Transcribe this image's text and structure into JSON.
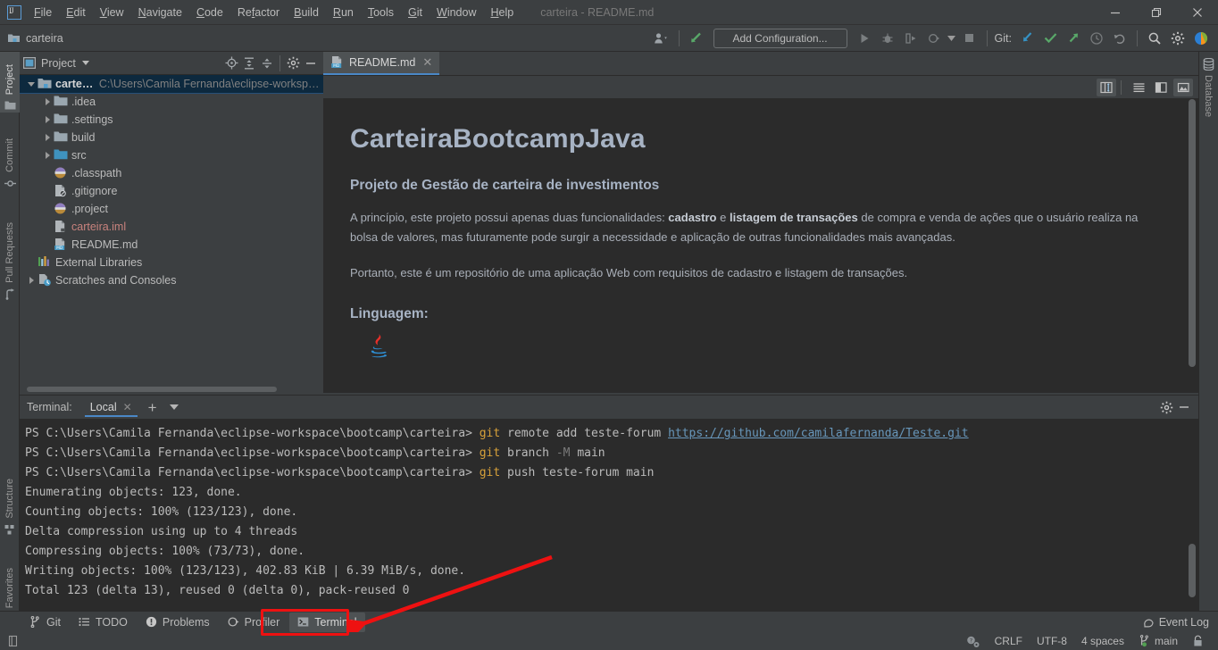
{
  "window": {
    "title": "carteira - README.md",
    "logo": "intellij-idea-logo",
    "minimize": "—",
    "maximize": "❐",
    "close": "✕"
  },
  "menubar": [
    {
      "label": "File",
      "mnemonic": "F"
    },
    {
      "label": "Edit",
      "mnemonic": "E"
    },
    {
      "label": "View",
      "mnemonic": "V"
    },
    {
      "label": "Navigate",
      "mnemonic": "N"
    },
    {
      "label": "Code",
      "mnemonic": "C"
    },
    {
      "label": "Refactor",
      "mnemonic": "R"
    },
    {
      "label": "Build",
      "mnemonic": "B"
    },
    {
      "label": "Run",
      "mnemonic": "R"
    },
    {
      "label": "Tools",
      "mnemonic": "T"
    },
    {
      "label": "Git",
      "mnemonic": "G"
    },
    {
      "label": "Window",
      "mnemonic": "W"
    },
    {
      "label": "Help",
      "mnemonic": "H"
    }
  ],
  "toolbar": {
    "breadcrumb": "carteira",
    "run_configuration": "Add Configuration...",
    "git_label": "Git:",
    "icons": [
      "user-profile-icon",
      "chevron-down-icon",
      "update-project-icon",
      "run-icon",
      "debug-icon",
      "run-coverage-icon",
      "profile-icon",
      "stop-icon",
      "update-git-icon",
      "commit-icon",
      "push-icon",
      "history-icon",
      "rollback-icon",
      "search-everywhere-icon",
      "settings-icon",
      "ide-feedback-icon"
    ]
  },
  "left_stripe": [
    {
      "label": "Project",
      "icon": "project-icon",
      "active": true
    },
    {
      "label": "Commit",
      "icon": "commit-icon",
      "active": false
    },
    {
      "label": "Pull Requests",
      "icon": "pull-requests-icon",
      "active": false
    },
    {
      "label": "Structure",
      "icon": "structure-icon",
      "active": false
    },
    {
      "label": "Favorites",
      "icon": "star-icon",
      "active": false
    }
  ],
  "right_stripe": [
    {
      "label": "Database",
      "icon": "database-icon",
      "active": false
    }
  ],
  "project_panel": {
    "title": "Project",
    "header_icons": [
      "select-opened-file-icon",
      "expand-all-icon",
      "collapse-all-icon",
      "settings-icon",
      "hide-icon"
    ],
    "tree": [
      {
        "label": "carteira",
        "detail": "C:\\Users\\Camila Fernanda\\eclipse-workspace\\b",
        "indent": 0,
        "twisty": "down",
        "icon": "project-folder-icon",
        "selected": true,
        "bold": true
      },
      {
        "label": ".idea",
        "detail": "",
        "indent": 1,
        "twisty": "right",
        "icon": "folder-icon",
        "selected": false,
        "bold": false
      },
      {
        "label": ".settings",
        "detail": "",
        "indent": 1,
        "twisty": "right",
        "icon": "folder-icon",
        "selected": false,
        "bold": false
      },
      {
        "label": "build",
        "detail": "",
        "indent": 1,
        "twisty": "right",
        "icon": "folder-icon",
        "selected": false,
        "bold": false
      },
      {
        "label": "src",
        "detail": "",
        "indent": 1,
        "twisty": "right",
        "icon": "source-folder-icon",
        "selected": false,
        "bold": false
      },
      {
        "label": ".classpath",
        "detail": "",
        "indent": 1,
        "twisty": "none",
        "icon": "file-classpath-icon",
        "selected": false,
        "bold": false
      },
      {
        "label": ".gitignore",
        "detail": "",
        "indent": 1,
        "twisty": "none",
        "icon": "file-gitignore-icon",
        "selected": false,
        "bold": false
      },
      {
        "label": ".project",
        "detail": "",
        "indent": 1,
        "twisty": "none",
        "icon": "file-classpath-icon",
        "selected": false,
        "bold": false
      },
      {
        "label": "carteira.iml",
        "detail": "",
        "indent": 1,
        "twisty": "none",
        "icon": "file-iml-icon",
        "selected": false,
        "bold": false,
        "color": "red"
      },
      {
        "label": "README.md",
        "detail": "",
        "indent": 1,
        "twisty": "none",
        "icon": "markdown-icon",
        "selected": false,
        "bold": false
      },
      {
        "label": "External Libraries",
        "detail": "",
        "indent": 0,
        "twisty": "none",
        "icon": "libraries-icon",
        "selected": false,
        "bold": false
      },
      {
        "label": "Scratches and Consoles",
        "detail": "",
        "indent": 0,
        "twisty": "right",
        "icon": "scratches-icon",
        "selected": false,
        "bold": false
      }
    ]
  },
  "editor": {
    "tab": {
      "label": "README.md",
      "icon": "markdown-icon",
      "close": "✕"
    },
    "preview_buttons": [
      "split-layout-icon",
      "show-source-icon",
      "show-split-icon",
      "show-preview-icon"
    ],
    "markdown": {
      "h1": "CarteiraBootcampJava",
      "h3": "Projeto de Gestão de carteira de investimentos",
      "p1_a": "A princípio, este projeto possui apenas duas funcionalidades: ",
      "p1_b1": "cadastro",
      "p1_c": " e ",
      "p1_b2": "listagem de transações",
      "p1_d": " de compra e venda de ações que o usuário realiza na bolsa de valores, mas futuramente pode surgir a necessidade e aplicação de outras funcionalidades mais avançadas.",
      "p2": "Portanto, este é um repositório de uma aplicação Web com requisitos de cadastro e listagem de transações.",
      "h3b": "Linguagem:",
      "java_logo_alt": "java-logo-icon"
    }
  },
  "terminal": {
    "header_label": "Terminal:",
    "tab_label": "Local",
    "tab_close": "✕",
    "new_tab": "+",
    "header_icons": [
      "settings-icon",
      "hide-icon"
    ],
    "prompt": "PS C:\\Users\\Camila Fernanda\\eclipse-workspace\\bootcamp\\carteira>",
    "lines": [
      {
        "type": "cmd",
        "prompt": true,
        "cmd": "git",
        "rest": " remote add teste-forum ",
        "link": "https://github.com/camilafernanda/Teste.git"
      },
      {
        "type": "cmd",
        "prompt": true,
        "cmd": "git",
        "rest": " branch ",
        "flag": "-M",
        "tail": " main"
      },
      {
        "type": "cmd",
        "prompt": true,
        "cmd": "git",
        "rest": " push teste-forum main"
      },
      {
        "type": "out",
        "text": "Enumerating objects: 123, done."
      },
      {
        "type": "out",
        "text": "Counting objects: 100% (123/123), done."
      },
      {
        "type": "out",
        "text": "Delta compression using up to 4 threads"
      },
      {
        "type": "out",
        "text": "Compressing objects: 100% (73/73), done."
      },
      {
        "type": "out",
        "text": "Writing objects: 100% (123/123), 402.83 KiB | 6.39 MiB/s, done."
      },
      {
        "type": "out",
        "text": "Total 123 (delta 13), reused 0 (delta 0), pack-reused 0"
      }
    ]
  },
  "bottom_bar": {
    "items": [
      {
        "label": "Git",
        "icon": "git-branch-icon",
        "selected": false
      },
      {
        "label": "TODO",
        "icon": "todo-icon",
        "selected": false
      },
      {
        "label": "Problems",
        "icon": "problems-icon",
        "selected": false
      },
      {
        "label": "Profiler",
        "icon": "profiler-icon",
        "selected": false
      },
      {
        "label": "Terminal",
        "icon": "terminal-icon",
        "selected": true
      }
    ],
    "event_log": {
      "label": "Event Log",
      "icon": "event-log-icon"
    }
  },
  "status_bar": {
    "left_icon": "toggle-toolbar-icon",
    "right": {
      "inspections_icon": "inspections-icon",
      "line_separator": "CRLF",
      "encoding": "UTF-8",
      "indent": "4 spaces",
      "branch": "main",
      "branch_icon": "git-branch-icon",
      "lock_icon": "read-only-lock-icon"
    }
  },
  "annotation": {
    "type": "red-highlight-box-and-arrow",
    "target": "Terminal",
    "color": "#ee1111"
  }
}
